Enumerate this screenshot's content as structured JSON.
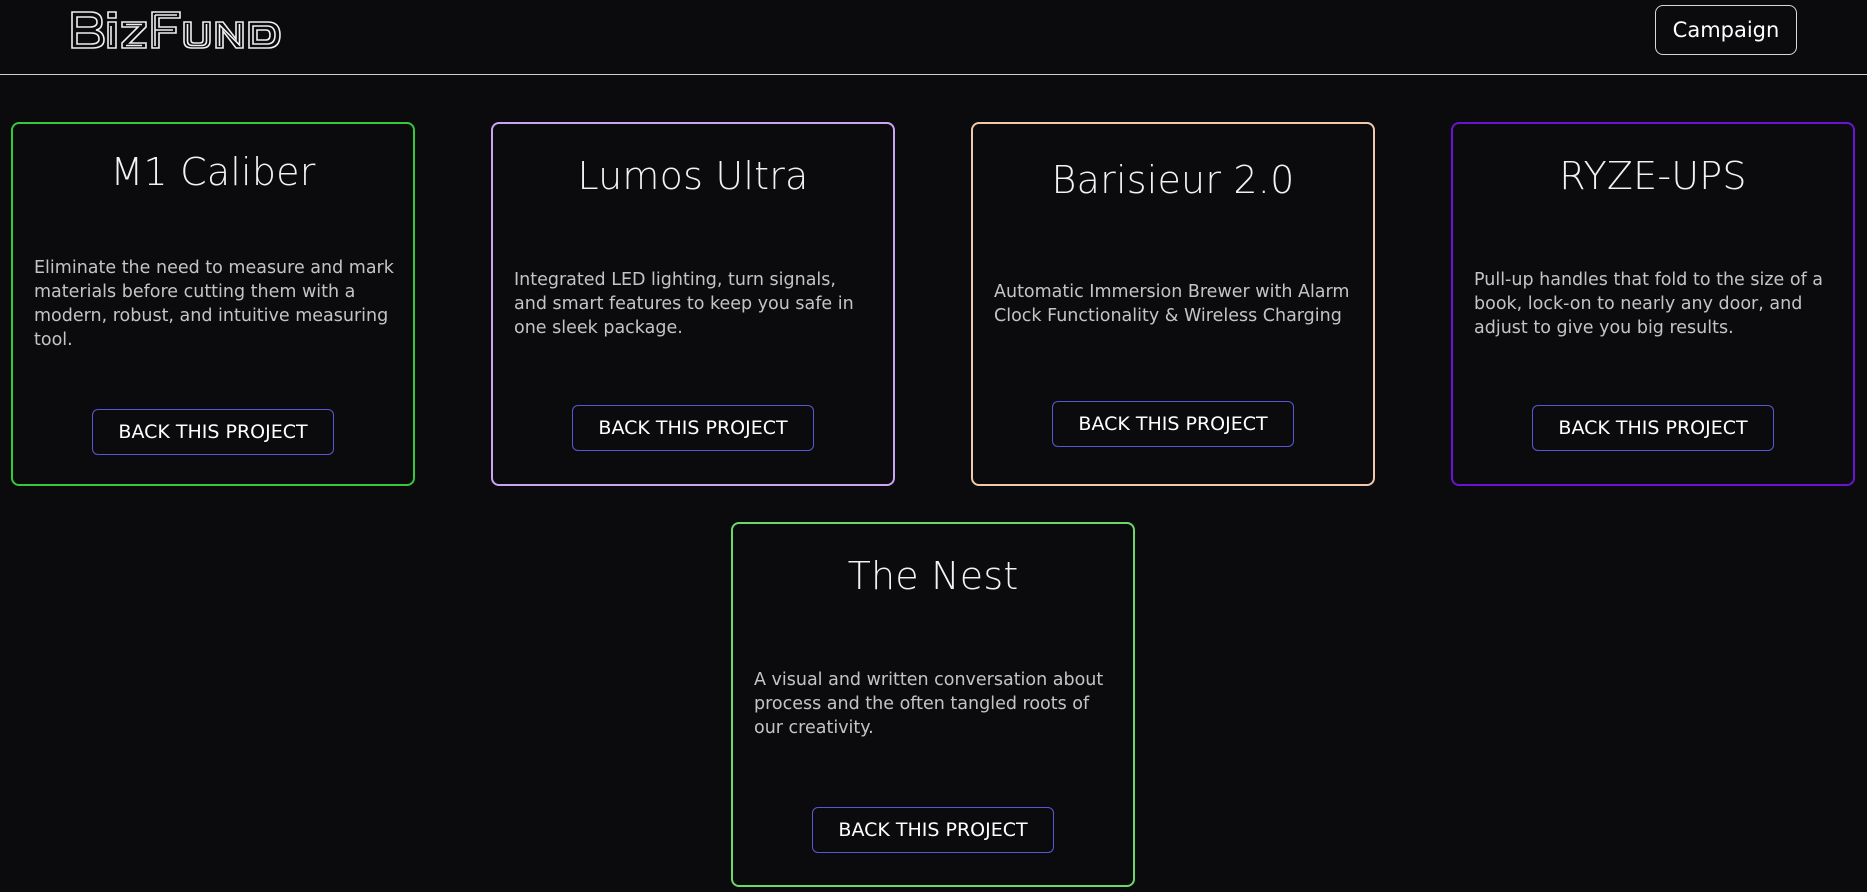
{
  "header": {
    "logo_text": "BizFund",
    "campaign_label": "Campaign"
  },
  "colors": {
    "background": "#0b0b0e",
    "button_border": "#5a57d6",
    "card_borders": [
      "#35c93a",
      "#c9a6f2",
      "#f2c9a8",
      "#6a12d6",
      "#6ad96a"
    ]
  },
  "projects": [
    {
      "title": "M1 Caliber",
      "description": "Eliminate the need to measure and mark materials before cutting them with a modern, robust, and intuitive measuring tool.",
      "button_label": "BACK THIS PROJECT"
    },
    {
      "title": "Lumos Ultra",
      "description": "Integrated LED lighting, turn signals, and smart features to keep you safe in one sleek package.",
      "button_label": "BACK THIS PROJECT"
    },
    {
      "title": "Barisieur 2.0",
      "description": "Automatic Immersion Brewer with Alarm Clock Functionality & Wireless Charging",
      "button_label": "BACK THIS PROJECT"
    },
    {
      "title": "RYZE-UPS",
      "description": "Pull-up handles that fold to the size of a book, lock-on to nearly any door, and adjust to give you big results.",
      "button_label": "BACK THIS PROJECT"
    },
    {
      "title": "The Nest",
      "description": "A visual and written conversation about process and the often tangled roots of our creativity.",
      "button_label": "BACK THIS PROJECT"
    }
  ]
}
